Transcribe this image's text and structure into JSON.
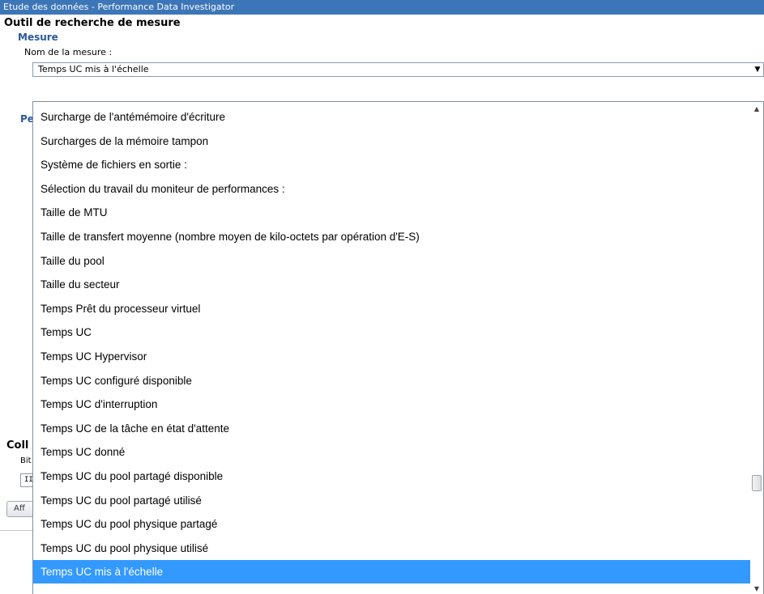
{
  "window": {
    "title": "Etude des données - Performance Data Investigator"
  },
  "panel": {
    "title": "Outil de recherche de mesure",
    "section_title": "Mesure",
    "field_label": "Nom de la mesure :",
    "selected_value": "Temps UC mis à l'échelle",
    "dropdown_arrow_icon": "chevron-down-icon"
  },
  "underlying": {
    "perf_heading_fragment": "Pe",
    "collection_heading_fragment": "Coll",
    "library_label_fragment": "Bit",
    "library_value_fragment": "II",
    "button_fragment": "Aff"
  },
  "dropdown": {
    "items": [
      "Surcharge de l'antémémoire d'écriture",
      "Surcharges de la mémoire tampon",
      "Système de fichiers en sortie :",
      "Sélection du travail du moniteur de performances :",
      "Taille de MTU",
      "Taille de transfert moyenne (nombre moyen de kilo-octets par opération d'E-S)",
      "Taille du pool",
      "Taille du secteur",
      "Temps Prêt du processeur virtuel",
      "Temps UC",
      "Temps UC Hypervisor",
      "Temps UC configuré disponible",
      "Temps UC d'interruption",
      "Temps UC de la tâche en état d'attente",
      "Temps UC donné",
      "Temps UC du pool partagé disponible",
      "Temps UC du pool partagé utilisé",
      "Temps UC du pool physique partagé",
      "Temps UC du pool physique utilisé",
      "Temps UC mis à l'échelle"
    ],
    "selected_index": 19,
    "scroll_up_icon": "scroll-up-arrow-icon",
    "scroll_down_icon": "scroll-down-arrow-icon",
    "colors": {
      "selection_background": "#3399ff",
      "selection_text": "#ffffff"
    }
  }
}
